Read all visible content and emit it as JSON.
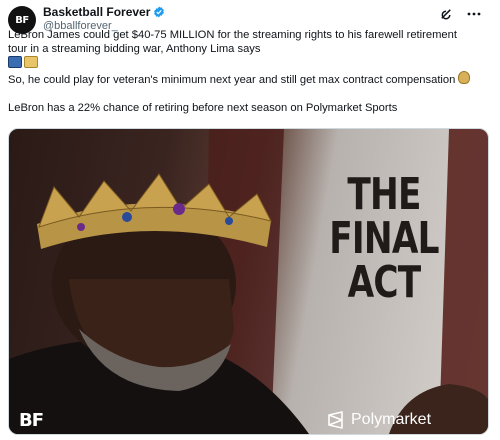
{
  "account": {
    "avatar_text": "BF",
    "display_name": "Basketball Forever",
    "handle": "@bballforever_",
    "verified_color": "#1d9bf0"
  },
  "header_icons": [
    "grok-icon",
    "more-icon"
  ],
  "tweet": {
    "paragraph1": "LeBron James could get $40-75 MILLION for the streaming rights to his farewell retirement tour in a streaming bidding war, Anthony Lima says",
    "paragraph2": "So, he could play for veteran's minimum next year and still get max contract compensation",
    "paragraph3": "LeBron has a 22% chance of retiring before next season on Polymarket Sports"
  },
  "media": {
    "headline_line1": "THE",
    "headline_line2": "FINAL",
    "headline_line3": "ACT",
    "logo_left": "BF",
    "logo_right": "Polymarket"
  }
}
